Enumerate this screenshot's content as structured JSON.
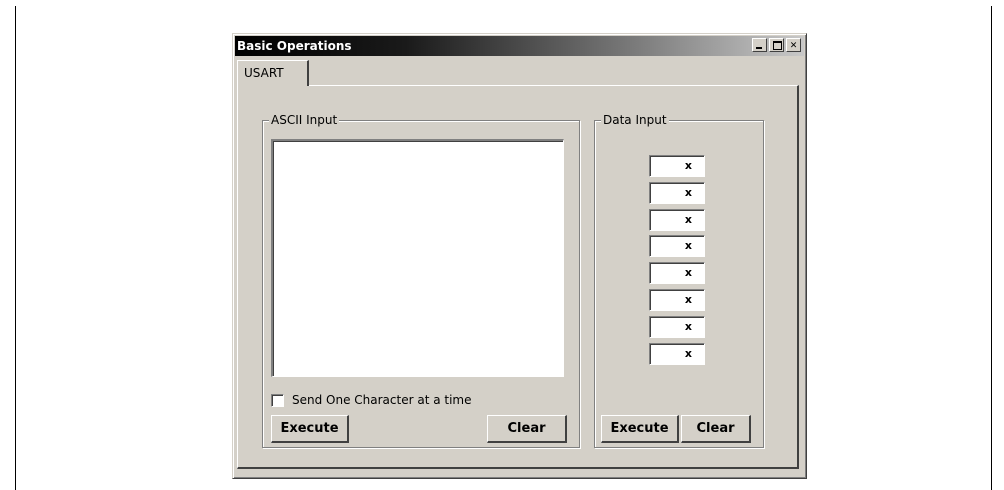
{
  "window": {
    "title": "Basic Operations",
    "close_glyph": "✕"
  },
  "tabs": [
    {
      "label": "USART",
      "selected": true
    }
  ],
  "ascii_input": {
    "group_label": "ASCII Input",
    "text_value": "",
    "send_one_char_label": "Send One Character at a time",
    "send_one_char_checked": false,
    "execute_label": "Execute",
    "clear_label": "Clear"
  },
  "data_input": {
    "group_label": "Data Input",
    "fields": [
      "x",
      "x",
      "x",
      "x",
      "x",
      "x",
      "x",
      "x"
    ],
    "execute_label": "Execute",
    "clear_label": "Clear"
  },
  "colors": {
    "face": "#d4d0c8",
    "title_start": "#000000",
    "title_end": "#c8c8c8"
  }
}
